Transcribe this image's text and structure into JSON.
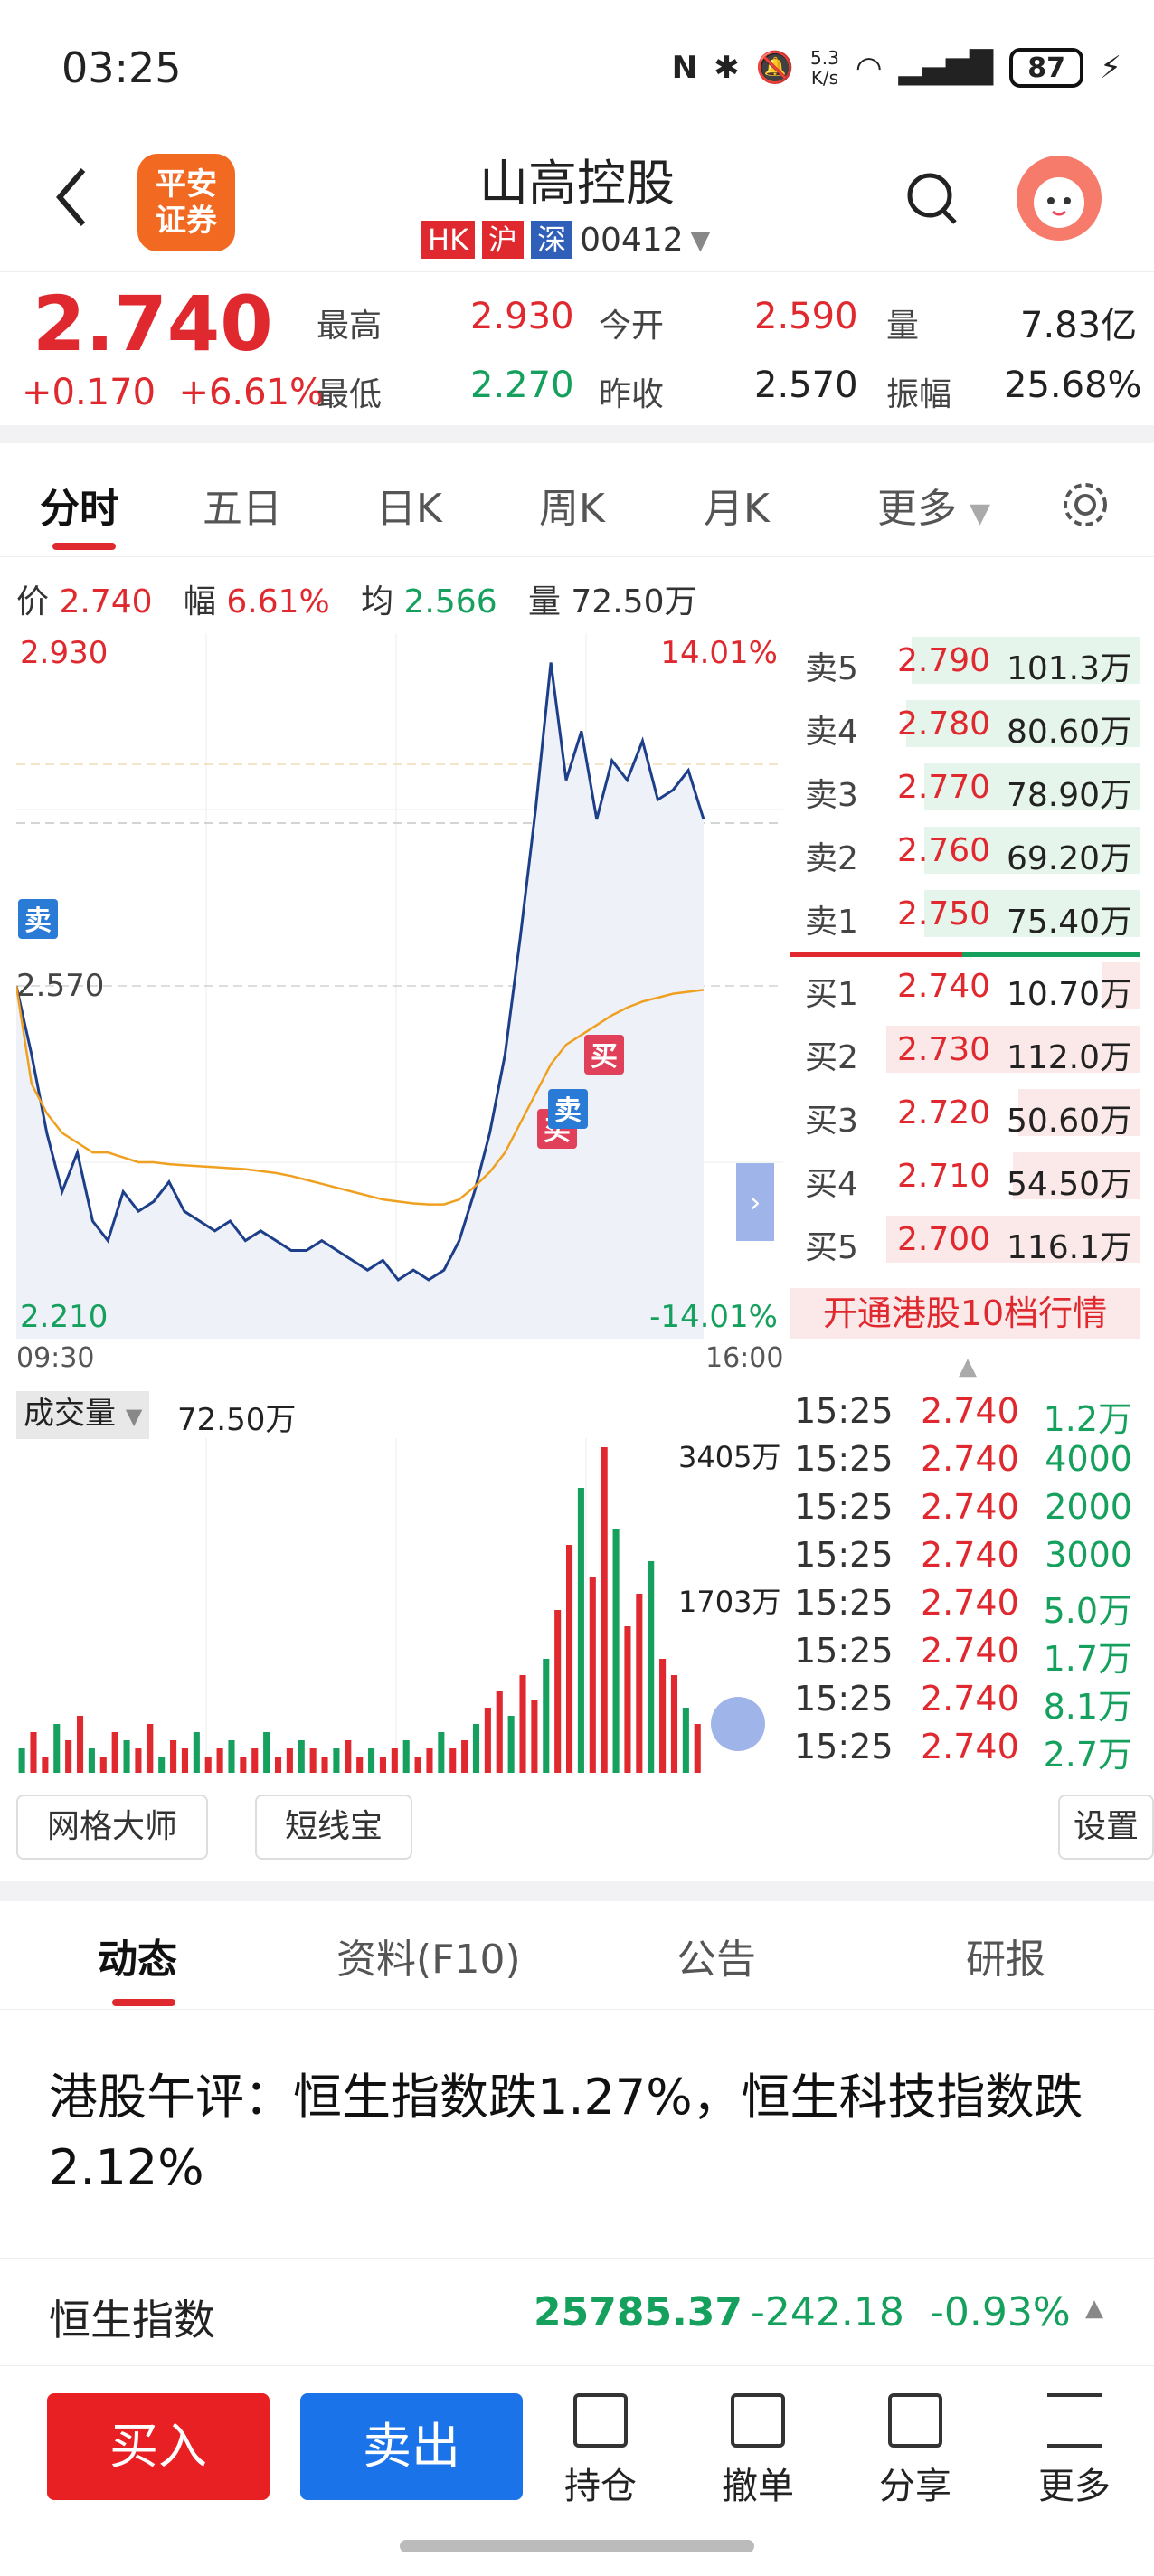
{
  "status": {
    "time": "03:25",
    "net_speed_top": "5.3",
    "net_speed_bottom": "K/s",
    "battery": "87"
  },
  "header": {
    "logo_line1": "平安",
    "logo_line2": "证券",
    "title": "山高控股",
    "tags": [
      "HK",
      "沪",
      "深"
    ],
    "code": "00412"
  },
  "quote": {
    "price": "2.740",
    "change": "+0.170",
    "change_pct": "+6.61%",
    "high_label": "最高",
    "high": "2.930",
    "low_label": "最低",
    "low": "2.270",
    "open_label": "今开",
    "open": "2.590",
    "prev_close_label": "昨收",
    "prev_close": "2.570",
    "volume_label": "量",
    "volume": "7.83亿",
    "amplitude_label": "振幅",
    "amplitude": "25.68%"
  },
  "tabs": [
    "分时",
    "五日",
    "日K",
    "周K",
    "月K",
    "更多"
  ],
  "info": {
    "price_label": "价",
    "price": "2.740",
    "pct_label": "幅",
    "pct": "6.61%",
    "avg_label": "均",
    "avg": "2.566",
    "vol_label": "量",
    "vol": "72.50万"
  },
  "chart_data": {
    "type": "line",
    "y_top": "2.930",
    "y_bottom": "2.210",
    "y_mid": "2.570",
    "pct_top": "14.01%",
    "pct_bottom": "-14.01%",
    "x_start": "09:30",
    "x_end": "16:00",
    "ylim": [
      2.21,
      2.93
    ],
    "series": [
      {
        "values": [
          2.57,
          2.5,
          2.42,
          2.36,
          2.4,
          2.33,
          2.31,
          2.36,
          2.34,
          2.35,
          2.37,
          2.34,
          2.33,
          2.32,
          2.33,
          2.31,
          2.32,
          2.31,
          2.3,
          2.3,
          2.31,
          2.3,
          2.29,
          2.28,
          2.29,
          2.27,
          2.28,
          2.27,
          2.28,
          2.31,
          2.36,
          2.42,
          2.5,
          2.62,
          2.75,
          2.9,
          2.78,
          2.83,
          2.74,
          2.8,
          2.78,
          2.82,
          2.76,
          2.77,
          2.79,
          2.74
        ]
      },
      {
        "values": [
          2.57,
          2.47,
          2.44,
          2.42,
          2.41,
          2.4,
          2.4,
          2.395,
          2.39,
          2.39,
          2.388,
          2.387,
          2.386,
          2.385,
          2.384,
          2.383,
          2.381,
          2.379,
          2.376,
          2.372,
          2.368,
          2.364,
          2.36,
          2.356,
          2.352,
          2.35,
          2.348,
          2.347,
          2.347,
          2.352,
          2.365,
          2.38,
          2.4,
          2.43,
          2.46,
          2.49,
          2.51,
          2.52,
          2.53,
          2.54,
          2.548,
          2.554,
          2.558,
          2.562,
          2.564,
          2.566
        ]
      }
    ],
    "markers": [
      "卖",
      "买",
      "卖",
      "买"
    ]
  },
  "orderbook": {
    "asks": [
      {
        "label": "卖5",
        "price": "2.790",
        "vol": "101.3万",
        "ratio": 0.9
      },
      {
        "label": "卖4",
        "price": "2.780",
        "vol": "80.60万",
        "ratio": 0.92
      },
      {
        "label": "卖3",
        "price": "2.770",
        "vol": "78.90万",
        "ratio": 0.85
      },
      {
        "label": "卖2",
        "price": "2.760",
        "vol": "69.20万",
        "ratio": 0.85
      },
      {
        "label": "卖1",
        "price": "2.750",
        "vol": "75.40万",
        "ratio": 0.85
      }
    ],
    "bids": [
      {
        "label": "买1",
        "price": "2.740",
        "vol": "10.70万",
        "ratio": 0.15
      },
      {
        "label": "买2",
        "price": "2.730",
        "vol": "112.0万",
        "ratio": 1.0
      },
      {
        "label": "买3",
        "price": "2.720",
        "vol": "50.60万",
        "ratio": 0.48
      },
      {
        "label": "买4",
        "price": "2.710",
        "vol": "54.50万",
        "ratio": 0.5
      },
      {
        "label": "买5",
        "price": "2.700",
        "vol": "116.1万",
        "ratio": 1.0
      }
    ],
    "upgrade": "开通港股10档行情"
  },
  "volume": {
    "label": "成交量",
    "value": "72.50万",
    "max_label": "3405万",
    "mid_label": "1703万"
  },
  "volume_data": [
    3,
    5,
    2,
    6,
    4,
    7,
    3,
    2,
    5,
    4,
    3,
    6,
    2,
    4,
    3,
    5,
    2,
    3,
    4,
    2,
    3,
    5,
    2,
    3,
    4,
    3,
    2,
    3,
    4,
    2,
    3,
    2,
    3,
    4,
    2,
    3,
    5,
    3,
    4,
    6,
    8,
    10,
    7,
    12,
    9,
    14,
    20,
    28,
    35,
    24,
    40,
    30,
    18,
    22,
    26,
    14,
    12,
    8,
    6
  ],
  "trades": [
    {
      "time": "15:25",
      "price": "2.740",
      "vol": "1.2万"
    },
    {
      "time": "15:25",
      "price": "2.740",
      "vol": "4000"
    },
    {
      "time": "15:25",
      "price": "2.740",
      "vol": "2000"
    },
    {
      "time": "15:25",
      "price": "2.740",
      "vol": "3000"
    },
    {
      "time": "15:25",
      "price": "2.740",
      "vol": "5.0万"
    },
    {
      "time": "15:25",
      "price": "2.740",
      "vol": "1.7万"
    },
    {
      "time": "15:25",
      "price": "2.740",
      "vol": "8.1万"
    },
    {
      "time": "15:25",
      "price": "2.740",
      "vol": "2.7万"
    }
  ],
  "toolbar": {
    "grid": "网格大师",
    "short": "短线宝",
    "settings": "设置"
  },
  "news_tabs": [
    "动态",
    "资料(F10)",
    "公告",
    "研报"
  ],
  "news": {
    "headline": "港股午评：恒生指数跌1.27%，恒生科技指数跌2.12%"
  },
  "index": {
    "name": "恒生指数",
    "value": "25785.37",
    "change": "-242.18",
    "pct": "-0.93%"
  },
  "bottom": {
    "buy": "买入",
    "sell": "卖出",
    "hold": "持仓",
    "cancel": "撤单",
    "share": "分享",
    "more": "更多"
  }
}
